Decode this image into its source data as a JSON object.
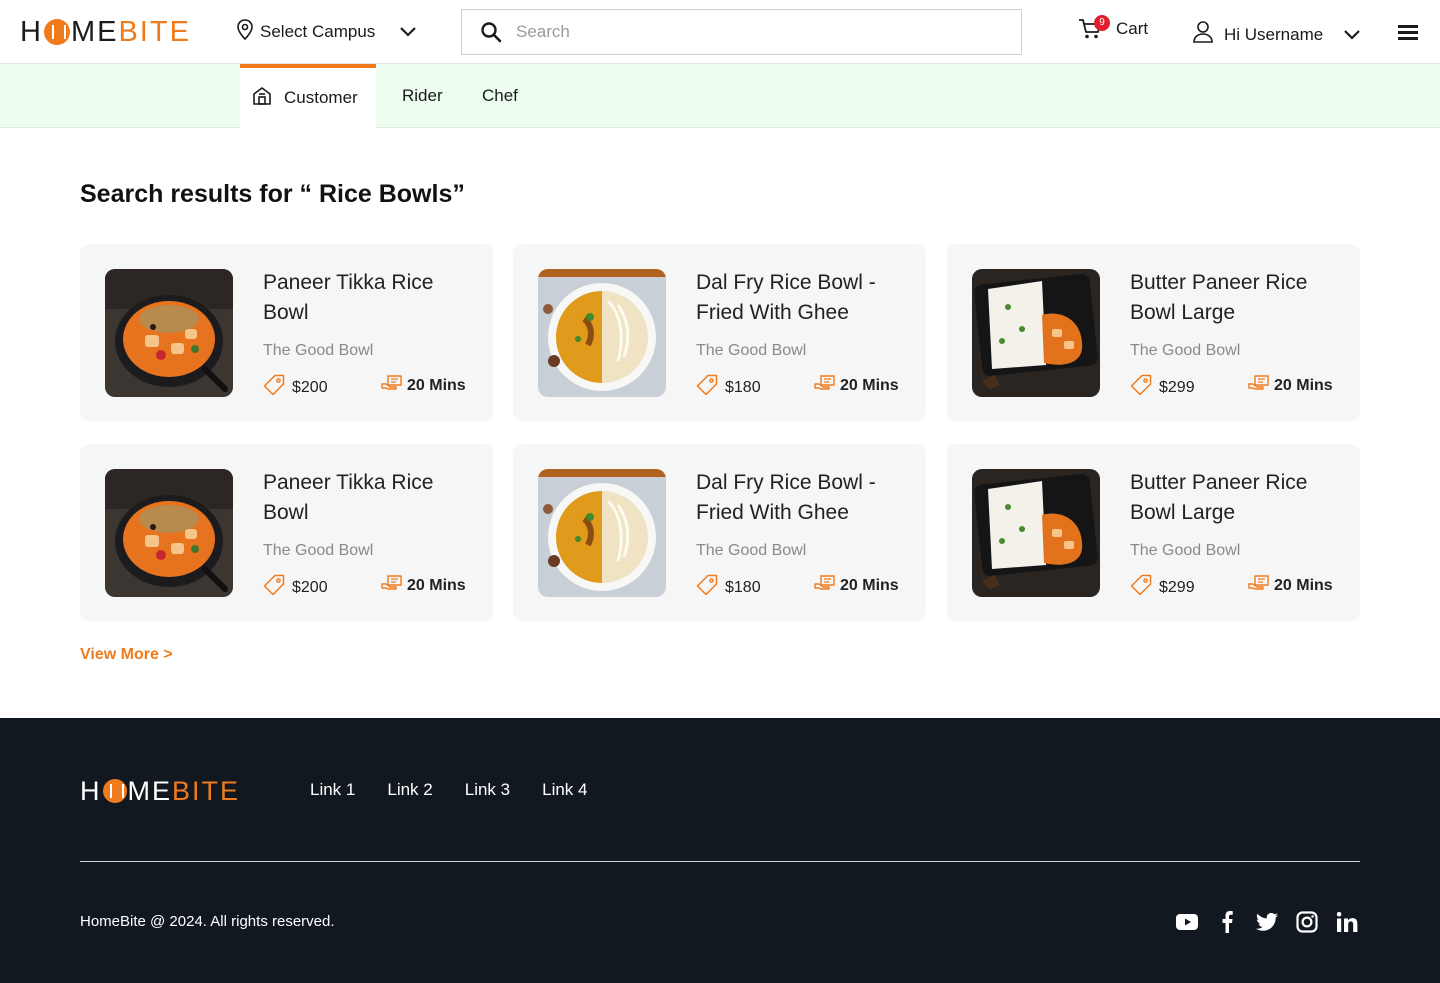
{
  "brand": {
    "name_prefix": "H",
    "name_mid": "ME",
    "name_suffix": "BITE",
    "accent": "#f07b1c"
  },
  "header": {
    "campus_label": "Select Campus",
    "search_placeholder": "Search",
    "cart_label": "Cart",
    "cart_count": "9",
    "user_label": "Hi Username"
  },
  "subnav": {
    "tabs": [
      {
        "label": "Customer",
        "active": true
      },
      {
        "label": "Rider"
      },
      {
        "label": "Chef"
      }
    ]
  },
  "main": {
    "results_title": "Search results for “ Rice Bowls”",
    "cards": [
      {
        "title": "Paneer Tikka Rice Bowl",
        "vendor": "The Good Bowl",
        "price": "$200",
        "time": "20 Mins",
        "image": "paneer-tikka-bowl"
      },
      {
        "title": "Dal Fry Rice Bowl - Fried With Ghee",
        "vendor": "The Good Bowl",
        "price": "$180",
        "time": "20 Mins",
        "image": "dal-fry-bowl"
      },
      {
        "title": "Butter Paneer Rice Bowl Large",
        "vendor": "The Good Bowl",
        "price": "$299",
        "time": "20 Mins",
        "image": "butter-paneer-bowl"
      },
      {
        "title": "Paneer Tikka Rice Bowl",
        "vendor": "The Good Bowl",
        "price": "$200",
        "time": "20 Mins",
        "image": "paneer-tikka-bowl"
      },
      {
        "title": "Dal Fry Rice Bowl - Fried With Ghee",
        "vendor": "The Good Bowl",
        "price": "$180",
        "time": "20 Mins",
        "image": "dal-fry-bowl"
      },
      {
        "title": "Butter Paneer Rice Bowl Large",
        "vendor": "The Good Bowl",
        "price": "$299",
        "time": "20 Mins",
        "image": "butter-paneer-bowl"
      }
    ],
    "view_more": "View More >"
  },
  "footer": {
    "links": [
      "Link 1",
      "Link 2",
      "Link 3",
      "Link 4"
    ],
    "copyright": "HomeBite @ 2024. All rights reserved.",
    "socials": [
      "youtube-icon",
      "facebook-icon",
      "twitter-icon",
      "instagram-icon",
      "linkedin-icon"
    ]
  }
}
